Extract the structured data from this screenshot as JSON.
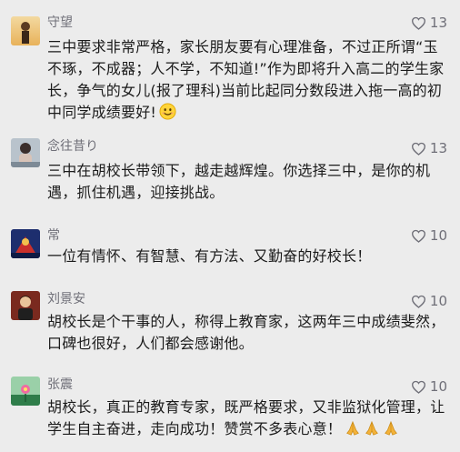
{
  "comments": [
    {
      "name": "守望",
      "likes": "13",
      "text": "三中要求非常严格，家长朋友要有心理准备，不过正所谓“玉不琢，不成器；人不学，不知道!”作为即将升入高二的学生家长，争气的女儿(报了理科)当前比起同分数段进入拖一高的初中同学成绩要好!",
      "emoji": "smiling-face"
    },
    {
      "name": "念往昔り",
      "likes": "13",
      "text": "三中在胡校长带领下，越走越辉煌。你选择三中，是你的机遇，抓住机遇，迎接挑战。"
    },
    {
      "name": "常",
      "likes": "10",
      "text": "一位有情怀、有智慧、有方法、又勤奋的好校长！"
    },
    {
      "name": "刘景安",
      "likes": "10",
      "text": "胡校长是个干事的人，称得上教育家，这两年三中成绩斐然，口碑也很好，人们都会感谢他。"
    },
    {
      "name": "张震",
      "likes": "10",
      "text": "胡校长，真正的教育专家，既严格要求，又非监狱化管理，让学生自主奋进，走向成功！赞赏不多表心意！",
      "emoji": "praying-hands x3"
    }
  ]
}
